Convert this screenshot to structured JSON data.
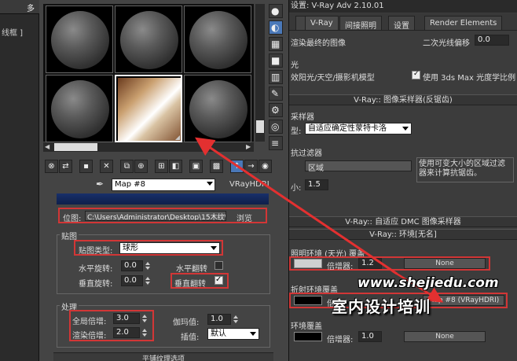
{
  "left_panel": {
    "tab_glyph": "多",
    "label": "线框 ]"
  },
  "material_editor": {
    "map_name": "Map #8",
    "map_type": "VRayHDRI",
    "path_label": "位图:",
    "path_value": "C:\\Users\\Administrator\\Desktop\\15木纹\\Y",
    "browse_label": "浏览",
    "mapping_group": "贴图",
    "mapping_type_label": "贴图类型:",
    "mapping_type_value": "球形",
    "h_rotate_label": "水平旋转:",
    "h_rotate_value": "0.0",
    "h_flip_label": "水平翻转",
    "v_rotate_label": "垂直旋转:",
    "v_rotate_value": "0.0",
    "v_flip_label": "垂直翻转",
    "v_flip_mark": "✓",
    "processing_group": "处理",
    "overall_mult_label": "全局倍增:",
    "overall_mult_value": "3.0",
    "render_mult_label": "渲染倍增:",
    "render_mult_value": "2.0",
    "gamma_label": "伽玛值:",
    "gamma_value": "1.0",
    "interp_label": "插值:",
    "interp_value": "默认",
    "bottom_label": "平铺纹理选项"
  },
  "vray_panel": {
    "title": "设置: V-Ray Adv 2.10.01",
    "tabs": [
      "V-Ray",
      "间接照明",
      "设置",
      "Render Elements"
    ],
    "render_final_label": "渲染最终的图像",
    "secondary_offset_label": "二次光线偏移",
    "secondary_offset_value": "0.0",
    "section_glyph": "光",
    "sun_sky_label": "效阳光/天空/摄影机模型",
    "use_3ds_label": "使用 3ds Max 光度学比例",
    "image_sampler_header": "V-Ray:: 图像采样器(反锯齿)",
    "sampler_label": "采样器",
    "type_label": "型:",
    "type_value": "自适应确定性蒙特卡洛",
    "filter_label": "抗过滤器",
    "filter_value": "区域",
    "filter_desc": "使用可变大小的区域过滤器来计算抗锯齿。",
    "size_label": "小:",
    "size_value": "1.5",
    "dmc_header": "V-Ray:: 自适应 DMC 图像采样器",
    "env_header": "V-Ray:: 环境[无名]",
    "gi_env_label": "照明环境 (天光) 覆盖",
    "gi_mult_label": "倍增器:",
    "gi_mult_value": "1.2",
    "gi_map": "None",
    "refl_env_label": "折射环境覆盖",
    "refl_mult_label": "倍",
    "refl_map": "Map #8 (VRayHDRI)",
    "refr_env_label": "环境覆盖",
    "refr_mult_label": "倍增器:",
    "refr_mult_value": "1.0",
    "refr_map": "None"
  },
  "watermark": {
    "url": "www.shejiedu.com",
    "text": "室内设计培训"
  },
  "colors": {
    "highlight": "#d23636",
    "accent": "#4a78b8"
  }
}
